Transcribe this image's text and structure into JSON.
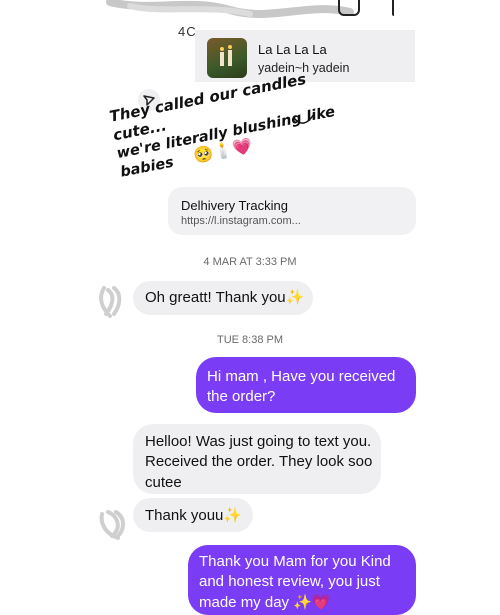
{
  "music": {
    "cropped_text_above": "4C...",
    "title": "La La La La",
    "artist": "yadein~h yadein"
  },
  "story_reply": {
    "caption_line1": "They called our candles cute...",
    "caption_line2": "we're literally blushing like babies",
    "emojis": "🥺🕯️💗"
  },
  "link_card": {
    "title": "Delhivery Tracking",
    "url": "https://l.instagram.com..."
  },
  "timestamps": {
    "first": "4 MAR AT 3:33 PM",
    "second": "TUE 8:38 PM"
  },
  "messages": [
    {
      "side": "in",
      "text": "Oh greatt! Thank you✨"
    },
    {
      "side": "out",
      "text": "Hi mam , Have you received the order?"
    },
    {
      "side": "in",
      "text": "Helloo! Was just going to text you. Received the order. They look soo cutee"
    },
    {
      "side": "in",
      "text": "Thank youu✨"
    },
    {
      "side": "out",
      "text": "Thank you Mam for you Kind and honest review, you just made my day ✨💗"
    }
  ],
  "colors": {
    "outgoing_bubble": "#7a3cf4",
    "incoming_bubble": "#efeff1",
    "background": "#ffffff"
  },
  "icons": {
    "share": "paper-plane-icon",
    "top_right": "square-icon"
  }
}
